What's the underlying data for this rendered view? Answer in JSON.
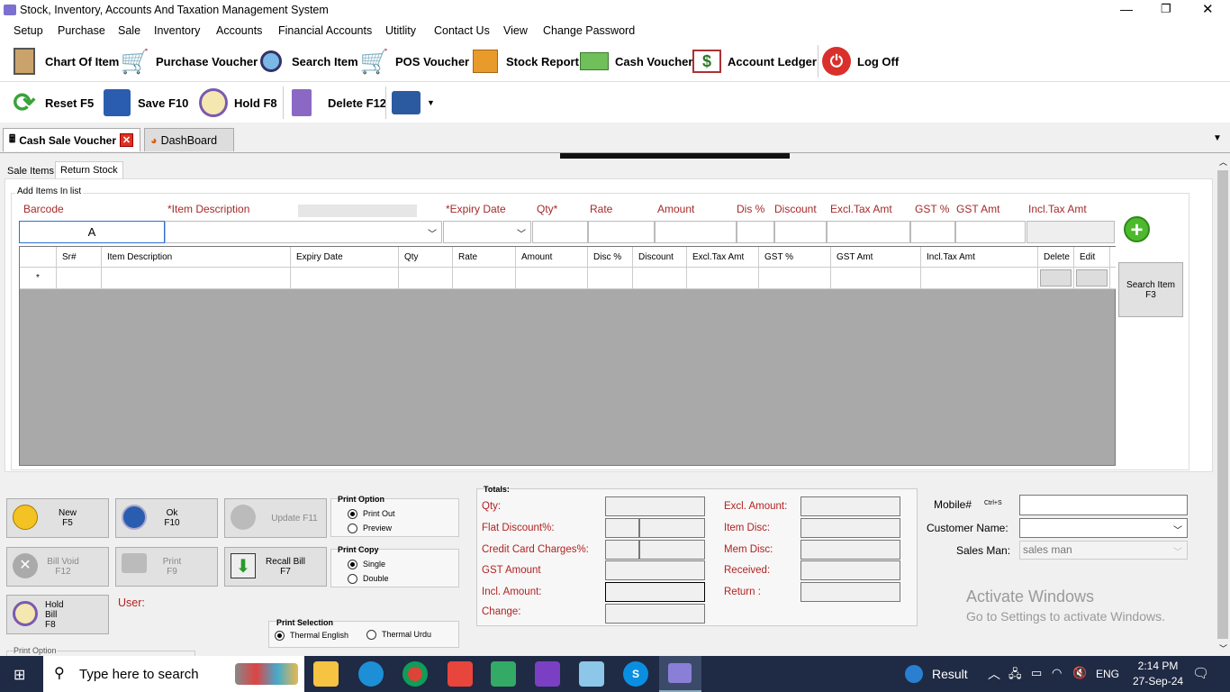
{
  "window": {
    "title": "Stock, Inventory, Accounts And Taxation Management System"
  },
  "menu": [
    "Setup",
    "Purchase",
    "Sale",
    "Inventory",
    "Accounts",
    "Financial Accounts",
    "Utitlity",
    "Contact Us",
    "View",
    "Change Password"
  ],
  "toolbar1": [
    "Chart Of Item",
    "Purchase Voucher",
    "Search Item",
    "POS Voucher",
    "Stock Report",
    "Cash Voucher",
    "Account Ledger",
    "Log Off"
  ],
  "toolbar2": [
    "Reset F5",
    "Save F10",
    "Hold F8",
    "Delete F12"
  ],
  "doc_tabs": [
    "Cash Sale Voucher",
    "DashBoard"
  ],
  "sub_tabs": [
    "Sale Items",
    "Return Stock"
  ],
  "add_items": {
    "legend": "Add Items In list",
    "barcode": "Barcode",
    "item_desc": "*Item Description",
    "expiry": "*Expiry Date",
    "qty": "Qty*",
    "rate": "Rate",
    "amount": "Amount",
    "dis_pct": "Dis %",
    "discount": "Discount",
    "excl": "Excl.Tax Amt",
    "gst_pct": "GST %",
    "gst_amt": "GST Amt",
    "incl": "Incl.Tax Amt",
    "barcode_value": "A"
  },
  "grid": {
    "columns": [
      "Sr#",
      "Item Description",
      "Expiry Date",
      "Qty",
      "Rate",
      "Amount",
      "Disc %",
      "Discount",
      "Excl.Tax Amt",
      "GST %",
      "GST Amt",
      "Incl.Tax Amt",
      "Delete",
      "Edit"
    ],
    "new_row_marker": "*"
  },
  "search_item_button": "Search Item\nF3",
  "buttons": {
    "new": "New\nF5",
    "ok": "Ok\nF10",
    "update": "Update F11",
    "bill_void": "Bill Void\nF12",
    "print": "Print\nF9",
    "recall": "Recall Bill\nF7",
    "hold": "Hold Bill\nF8"
  },
  "user_label": "User:",
  "print_option": {
    "title": "Print Option",
    "a": "Print Out",
    "b": "Preview"
  },
  "print_copy": {
    "title": "Print Copy",
    "a": "Single",
    "b": "Double"
  },
  "print_selection": {
    "title": "Print Selection",
    "a": "Thermal English",
    "b": "Thermal Urdu"
  },
  "print_option_bottom": "Print Option",
  "totals": {
    "title": "Totals:",
    "qty": "Qty:",
    "flat": "Flat Discount%:",
    "cc": "Credit Card Charges%:",
    "gst": "GST Amount",
    "incl": "Incl. Amount:",
    "change": "Change:",
    "excl": "Excl. Amount:",
    "item_disc": "Item Disc:",
    "mem_disc": "Mem Disc:",
    "received": "Received:",
    "return": "Return :"
  },
  "customer": {
    "mobile": "Mobile#",
    "shortcut": "Ctrl+S",
    "name": "Customer Name:",
    "salesman": "Sales Man:",
    "salesman_value": "sales man"
  },
  "watermark": {
    "line1": "Activate Windows",
    "line2": "Go to Settings to activate Windows."
  },
  "taskbar": {
    "search": "Type here to search",
    "weather": "Result",
    "lang": "ENG",
    "time": "2:14 PM",
    "date": "27-Sep-24"
  }
}
